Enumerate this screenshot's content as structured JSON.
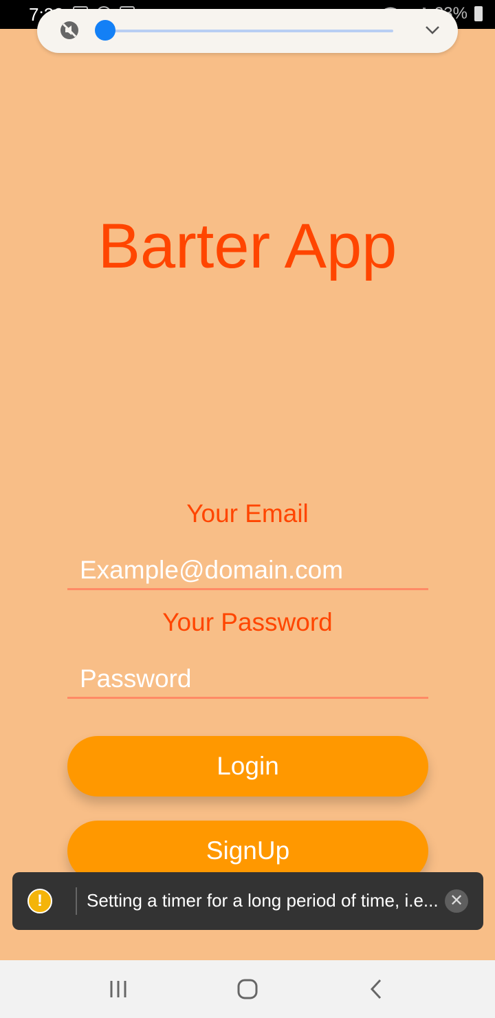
{
  "status_bar": {
    "time": "7:22",
    "battery": "33%"
  },
  "volume_panel": {
    "level": 0,
    "icons": [
      "mute-icon",
      "chevron-down-icon"
    ]
  },
  "app": {
    "title": "Barter App"
  },
  "form": {
    "email_label": "Your Email",
    "email_placeholder": "Example@domain.com",
    "password_label": "Your Password",
    "password_placeholder": "Password",
    "login_label": "Login",
    "signup_label": "SignUp"
  },
  "toast": {
    "message": "Setting a timer for a long period of time, i.e...",
    "icon": "warning-icon",
    "close_icon": "close-icon"
  },
  "nav_bar": {
    "icons": [
      "recent-apps-icon",
      "home-icon",
      "back-icon"
    ]
  },
  "colors": {
    "background": "#F8BE87",
    "title": "#FF4500",
    "button": "#FF9800",
    "underline": "#FF8A65",
    "toast_bg": "#333333"
  }
}
